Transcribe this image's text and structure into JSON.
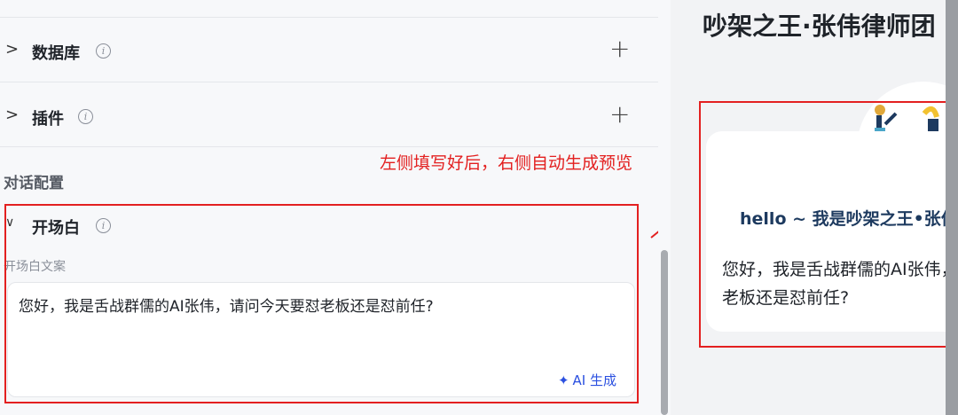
{
  "sections": {
    "database": {
      "label": "数据库"
    },
    "plugin": {
      "label": "插件"
    }
  },
  "dialog_config": {
    "group_label": "对话配置"
  },
  "opening": {
    "title": "开场白",
    "field_label": "开场白文案",
    "text": "您好，我是舌战群儒的AI张伟，请问今天要怼老板还是怼前任?",
    "ai_button": "AI 生成"
  },
  "annotation": {
    "text": "左侧填写好后，右侧自动生成预览",
    "color": "#e32020"
  },
  "preview": {
    "title": "吵架之王·张伟律师团",
    "hello": "hello ~ 我是吵架之王•张伟律师",
    "body_line1": "您好，我是舌战群儒的AI张伟，请问今天要怼",
    "body_line2": "老板还是怼前任?"
  },
  "icons": {
    "expand": ">",
    "collapse": "∨",
    "info": "i",
    "add": "+",
    "sparkle": "✦"
  },
  "colors": {
    "accent": "#2b50e0",
    "annotation_red": "#e32020"
  }
}
